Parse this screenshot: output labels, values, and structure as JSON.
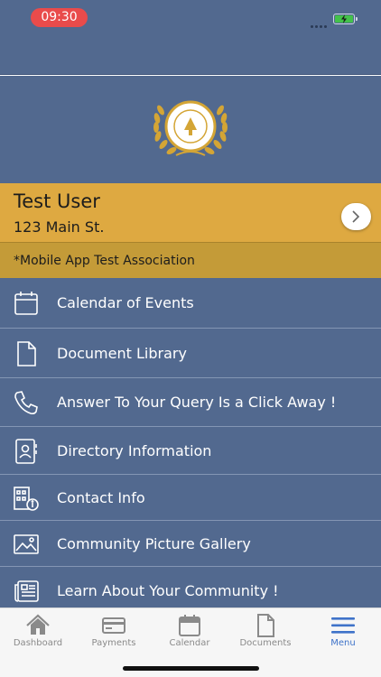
{
  "status_bar": {
    "time": "09:30"
  },
  "profile": {
    "name": "Test User",
    "address": "123 Main St.",
    "association": "*Mobile App Test Association"
  },
  "menu": {
    "items": [
      {
        "label": "Calendar of Events",
        "icon": "calendar-icon"
      },
      {
        "label": "Document Library",
        "icon": "document-icon"
      },
      {
        "label": "Answer To Your Query Is a Click Away !",
        "icon": "phone-icon"
      },
      {
        "label": "Directory Information",
        "icon": "contact-book-icon"
      },
      {
        "label": "Contact Info",
        "icon": "building-info-icon"
      },
      {
        "label": "Community Picture Gallery",
        "icon": "picture-icon"
      },
      {
        "label": "Learn About Your Community !",
        "icon": "newspaper-icon"
      }
    ]
  },
  "tab_bar": {
    "tabs": [
      {
        "label": "Dashboard",
        "icon": "home-icon"
      },
      {
        "label": "Payments",
        "icon": "credit-card-icon"
      },
      {
        "label": "Calendar",
        "icon": "calendar-icon"
      },
      {
        "label": "Documents",
        "icon": "document-icon"
      },
      {
        "label": "Menu",
        "icon": "hamburger-menu-icon",
        "active": true
      }
    ]
  },
  "colors": {
    "header_blue": "#52698f",
    "gold": "#dea941",
    "gold_dark": "#c49b38",
    "active_tab": "#3f73c9"
  }
}
